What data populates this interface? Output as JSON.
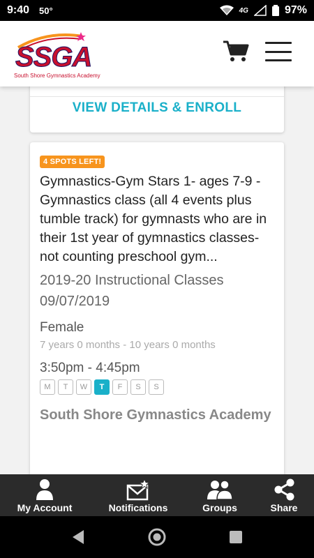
{
  "status_bar": {
    "time": "9:40",
    "temperature": "50°",
    "network": "4G",
    "battery": "97%"
  },
  "header": {
    "logo_text": "SSGA",
    "logo_subtitle": "South Shore Gymnastics Academy",
    "cart_icon": "cart-icon",
    "menu_icon": "hamburger-menu-icon"
  },
  "previous_card": {
    "enroll_label": "VIEW DETAILS & ENROLL"
  },
  "class_card": {
    "badge": "4 SPOTS LEFT!",
    "title": "Gymnastics-Gym Stars 1- ages 7-9 - Gymnastics class (all 4 events plus tumble track) for gymnasts who are in their 1st year of gymnastics classes-not counting preschool gym...",
    "season": "2019-20 Instructional Classes",
    "date": "09/07/2019",
    "gender": "Female",
    "age_range": "7 years 0 months - 10 years 0 months",
    "time": "3:50pm - 4:45pm",
    "days": [
      {
        "label": "M",
        "active": false
      },
      {
        "label": "T",
        "active": false
      },
      {
        "label": "W",
        "active": false
      },
      {
        "label": "T",
        "active": true
      },
      {
        "label": "F",
        "active": false
      },
      {
        "label": "S",
        "active": false
      },
      {
        "label": "S",
        "active": false
      }
    ],
    "location": "South Shore Gymnastics Academy"
  },
  "bottom_nav": {
    "items": [
      {
        "label": "My Account",
        "icon": "user-icon"
      },
      {
        "label": "Notifications",
        "icon": "envelope-star-icon"
      },
      {
        "label": "Groups",
        "icon": "group-icon"
      },
      {
        "label": "Share",
        "icon": "share-icon"
      }
    ]
  },
  "colors": {
    "accent": "#1ab0c9",
    "badge": "#f7941d",
    "logo_red": "#c8102e",
    "logo_navy": "#1b1464",
    "nav_bg": "#2b2b2b"
  }
}
